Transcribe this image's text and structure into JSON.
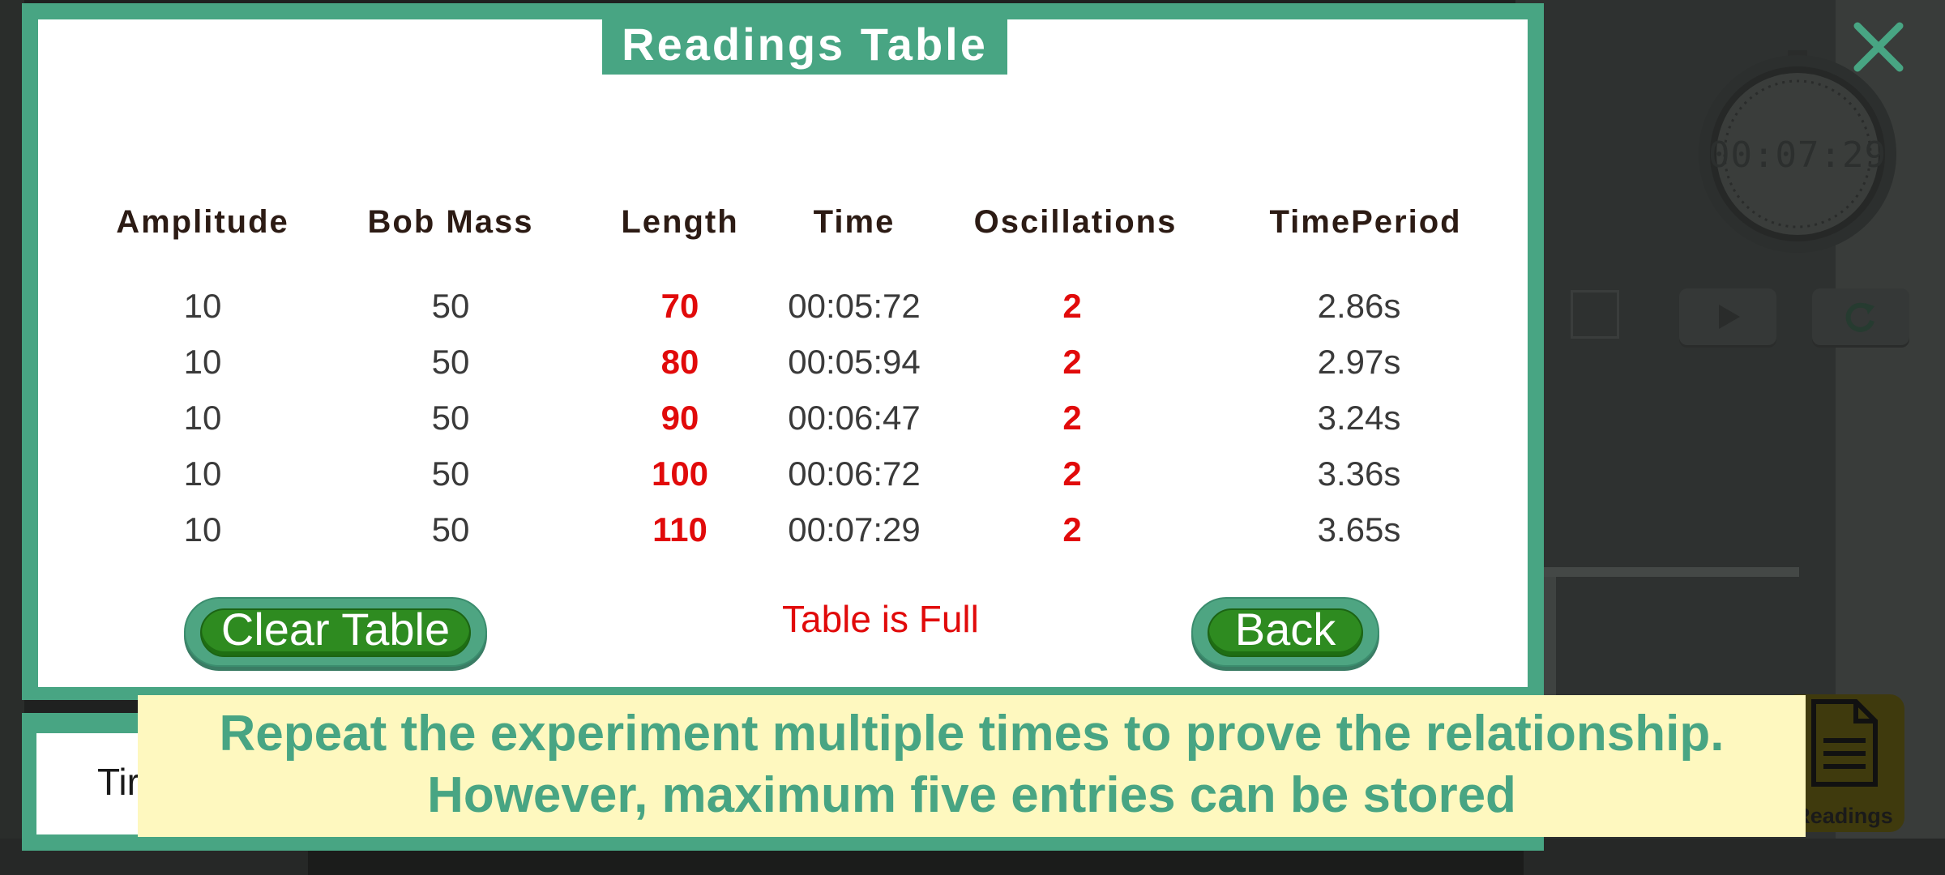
{
  "modal": {
    "title": "Readings Table",
    "columns": [
      "Amplitude",
      "Bob Mass",
      "Length",
      "Time",
      "Oscillations",
      "TimePeriod"
    ],
    "rows": [
      {
        "amplitude": "10",
        "bob_mass": "50",
        "length": "70",
        "time": "00:05:72",
        "oscillations": "2",
        "time_period": "2.86s"
      },
      {
        "amplitude": "10",
        "bob_mass": "50",
        "length": "80",
        "time": "00:05:94",
        "oscillations": "2",
        "time_period": "2.97s"
      },
      {
        "amplitude": "10",
        "bob_mass": "50",
        "length": "90",
        "time": "00:06:47",
        "oscillations": "2",
        "time_period": "3.24s"
      },
      {
        "amplitude": "10",
        "bob_mass": "50",
        "length": "100",
        "time": "00:06:72",
        "oscillations": "2",
        "time_period": "3.36s"
      },
      {
        "amplitude": "10",
        "bob_mass": "50",
        "length": "110",
        "time": "00:07:29",
        "oscillations": "2",
        "time_period": "3.65s"
      }
    ],
    "clear_label": "Clear Table",
    "back_label": "Back",
    "status": "Table is Full"
  },
  "banner": {
    "line1": "Repeat the experiment multiple times to prove the relationship.",
    "line2": "However, maximum five entries can be stored"
  },
  "stopwatch": {
    "display": "00:07:29"
  },
  "controls": {
    "readings_label": "Readings",
    "icons": [
      "close-icon",
      "stop-icon",
      "play-icon",
      "reset-icon",
      "document-icon"
    ]
  },
  "lower_panel": {
    "text": "Tir"
  },
  "colors": {
    "accent": "#48a583",
    "button_green": "#2e8b20",
    "highlight_red": "#e10a0a",
    "banner_bg": "#fef8bf"
  }
}
